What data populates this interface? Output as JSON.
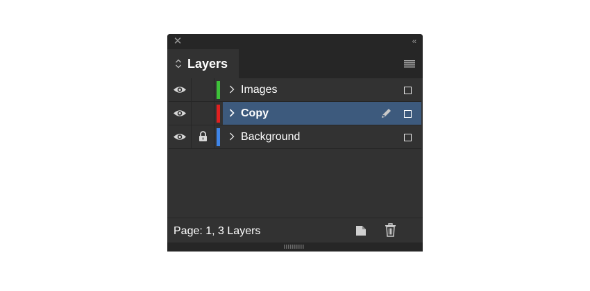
{
  "panel": {
    "close_glyph": "✕",
    "collapse_glyph": "‹‹",
    "tab_label": "Layers",
    "icons": {
      "close": "close-icon",
      "collapse": "collapse-panel-icon",
      "tab_arrows": "tab-expand-arrows-icon",
      "menu": "panel-menu-icon"
    }
  },
  "layers": [
    {
      "name": "Images",
      "color": "#3ec13a",
      "visible": true,
      "locked": false,
      "selected": false
    },
    {
      "name": "Copy",
      "color": "#e02020",
      "visible": true,
      "locked": false,
      "selected": true
    },
    {
      "name": "Background",
      "color": "#3f85e8",
      "visible": true,
      "locked": true,
      "selected": false
    }
  ],
  "footer": {
    "status": "Page: 1, 3 Layers",
    "icons": {
      "new_layer": "new-layer-icon",
      "delete": "trash-icon"
    }
  },
  "colors": {
    "panel_bg": "#323232",
    "chrome_bg": "#262626",
    "selection": "#3d5a7d",
    "text": "#ffffff"
  }
}
